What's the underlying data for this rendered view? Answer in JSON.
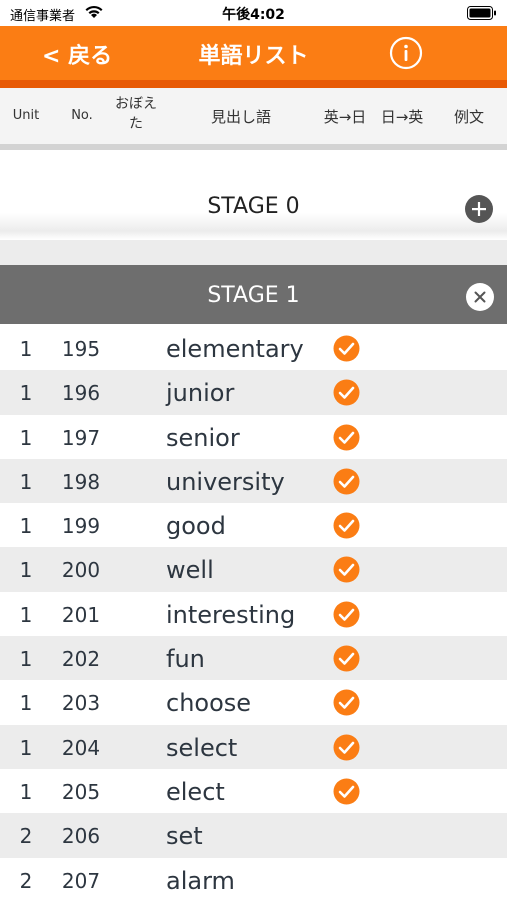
{
  "status_bar": {
    "carrier": "通信事業者",
    "time": "午後4:02"
  },
  "nav": {
    "back_label": "< 戻る",
    "title": "単語リスト",
    "info_icon": "info-circle-icon"
  },
  "header": {
    "unit": "Unit",
    "no": "No.",
    "memorized_line1": "おぼえ",
    "memorized_line2": "た",
    "headword": "見出し語",
    "en_to_ja": "英→日",
    "ja_to_en": "日→英",
    "example": "例文"
  },
  "stages": [
    {
      "label": "STAGE 0",
      "action_icon": "plus-circle-icon"
    },
    {
      "label": "STAGE 1",
      "action_icon": "close-circle-icon"
    }
  ],
  "words": [
    {
      "unit": "1",
      "no": "195",
      "word": "elementary",
      "checked": true
    },
    {
      "unit": "1",
      "no": "196",
      "word": "junior",
      "checked": true
    },
    {
      "unit": "1",
      "no": "197",
      "word": "senior",
      "checked": true
    },
    {
      "unit": "1",
      "no": "198",
      "word": "university",
      "checked": true
    },
    {
      "unit": "1",
      "no": "199",
      "word": "good",
      "checked": true
    },
    {
      "unit": "1",
      "no": "200",
      "word": "well",
      "checked": true
    },
    {
      "unit": "1",
      "no": "201",
      "word": "interesting",
      "checked": true
    },
    {
      "unit": "1",
      "no": "202",
      "word": "fun",
      "checked": true
    },
    {
      "unit": "1",
      "no": "203",
      "word": "choose",
      "checked": true
    },
    {
      "unit": "1",
      "no": "204",
      "word": "select",
      "checked": true
    },
    {
      "unit": "1",
      "no": "205",
      "word": "elect",
      "checked": true
    },
    {
      "unit": "2",
      "no": "206",
      "word": "set",
      "checked": false
    },
    {
      "unit": "2",
      "no": "207",
      "word": "alarm",
      "checked": false
    }
  ],
  "colors": {
    "accent": "#fb7d14",
    "accent_dark": "#e85a05",
    "stage_header": "#6e6e6e",
    "row_alt": "#ececec"
  }
}
